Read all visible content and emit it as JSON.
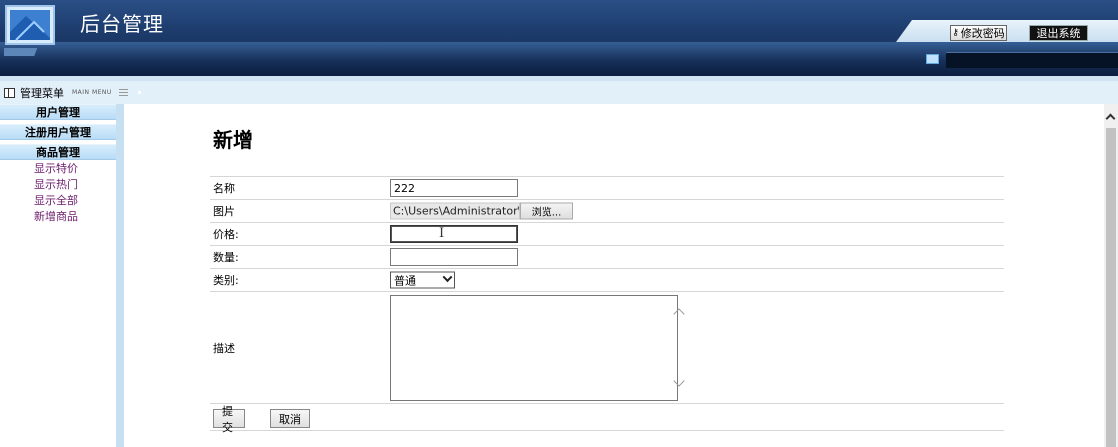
{
  "header": {
    "title": "后台管理",
    "change_password_label": "修改密码",
    "logout_label": "退出系统"
  },
  "menubar": {
    "title": "管理菜单",
    "subtitle_en": "MAIN MENU"
  },
  "sidebar": {
    "groups": [
      {
        "label": "用户管理"
      },
      {
        "label": "注册用户管理"
      },
      {
        "label": "商品管理",
        "items": [
          "显示特价",
          "显示热门",
          "显示全部",
          "新增商品"
        ]
      }
    ]
  },
  "form": {
    "title": "新增",
    "name": {
      "label": "名称",
      "value": "222"
    },
    "image": {
      "label": "图片",
      "path": "C:\\Users\\Administrator\\De",
      "browse_label": "浏览..."
    },
    "price": {
      "label": "价格:",
      "value": ""
    },
    "quantity": {
      "label": "数量:",
      "value": ""
    },
    "category": {
      "label": "类别:",
      "selected": "普通"
    },
    "description": {
      "label": "描述",
      "value": ""
    },
    "submit_label": "提交",
    "cancel_label": "取消"
  },
  "colors": {
    "header_dark": "#152d56",
    "menu_bg": "#e2f0fa",
    "sidebar_group": "#b8dcf6",
    "sidebar_link": "#6b1c6b"
  }
}
